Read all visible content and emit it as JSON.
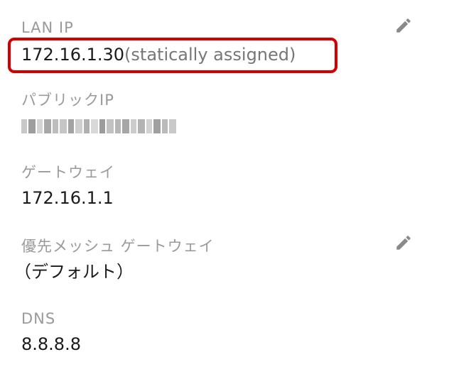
{
  "lan_ip": {
    "label": "LAN IP",
    "value": "172.16.1.30",
    "suffix": "(statically assigned)",
    "edit_icon": "pencil-icon"
  },
  "public_ip": {
    "label": "パブリックIP",
    "value_state": "redacted (pixelated)"
  },
  "gateway": {
    "label": "ゲートウェイ",
    "value": "172.16.1.1"
  },
  "preferred_mesh_gateway": {
    "label": "優先メッシュ ゲートウェイ",
    "value": "（デフォルト）",
    "edit_icon": "pencil-icon"
  },
  "dns": {
    "label": "DNS",
    "value": "8.8.8.8"
  },
  "colors": {
    "highlight_border": "#d40000",
    "label": "#9a9a9a",
    "value": "#1a1a1a",
    "icon": "#8a8a8a"
  }
}
